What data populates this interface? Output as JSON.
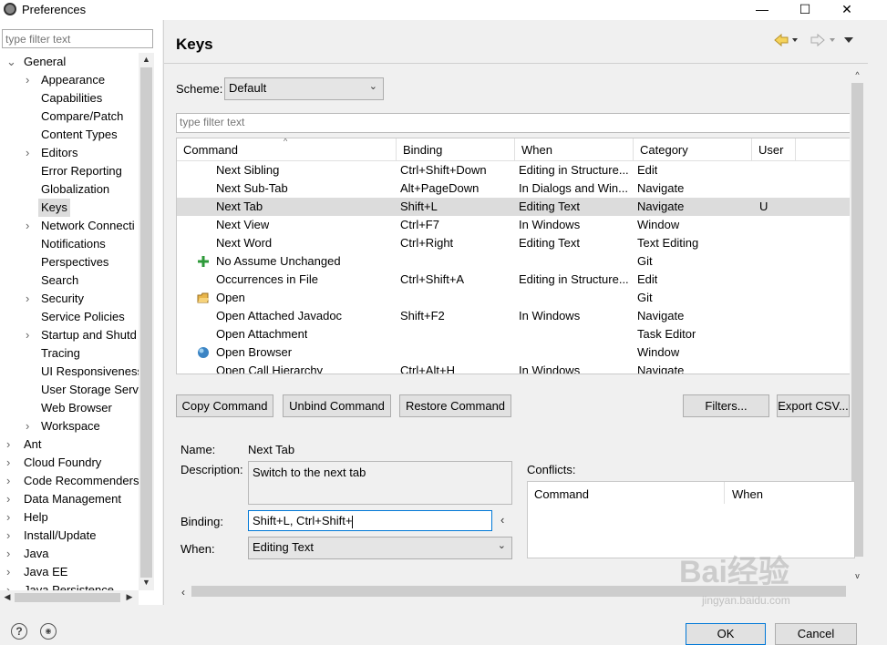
{
  "window": {
    "title": "Preferences",
    "minimize": "—",
    "maximize": "☐",
    "close": "✕"
  },
  "sidebar": {
    "filter_placeholder": "type filter text",
    "items": [
      {
        "label": "General",
        "level": 0,
        "expanded": true
      },
      {
        "label": "Appearance",
        "level": 1,
        "expandable": true
      },
      {
        "label": "Capabilities",
        "level": 1
      },
      {
        "label": "Compare/Patch",
        "level": 1
      },
      {
        "label": "Content Types",
        "level": 1
      },
      {
        "label": "Editors",
        "level": 1,
        "expandable": true
      },
      {
        "label": "Error Reporting",
        "level": 1
      },
      {
        "label": "Globalization",
        "level": 1
      },
      {
        "label": "Keys",
        "level": 1,
        "selected": true
      },
      {
        "label": "Network Connecti",
        "level": 1,
        "expandable": true
      },
      {
        "label": "Notifications",
        "level": 1
      },
      {
        "label": "Perspectives",
        "level": 1
      },
      {
        "label": "Search",
        "level": 1
      },
      {
        "label": "Security",
        "level": 1,
        "expandable": true
      },
      {
        "label": "Service Policies",
        "level": 1
      },
      {
        "label": "Startup and Shutd",
        "level": 1,
        "expandable": true
      },
      {
        "label": "Tracing",
        "level": 1
      },
      {
        "label": "UI Responsiveness",
        "level": 1
      },
      {
        "label": "User Storage Serv",
        "level": 1
      },
      {
        "label": "Web Browser",
        "level": 1
      },
      {
        "label": "Workspace",
        "level": 1,
        "expandable": true
      },
      {
        "label": "Ant",
        "level": 0,
        "expandable": true
      },
      {
        "label": "Cloud Foundry",
        "level": 0,
        "expandable": true
      },
      {
        "label": "Code Recommenders",
        "level": 0,
        "expandable": true
      },
      {
        "label": "Data Management",
        "level": 0,
        "expandable": true
      },
      {
        "label": "Help",
        "level": 0,
        "expandable": true
      },
      {
        "label": "Install/Update",
        "level": 0,
        "expandable": true
      },
      {
        "label": "Java",
        "level": 0,
        "expandable": true
      },
      {
        "label": "Java EE",
        "level": 0,
        "expandable": true
      },
      {
        "label": "Java Persistence",
        "level": 0,
        "expandable": true
      }
    ]
  },
  "main": {
    "title": "Keys",
    "scheme_label": "Scheme:",
    "scheme_value": "Default",
    "filter_placeholder": "type filter text",
    "columns": [
      "Command",
      "Binding",
      "When",
      "Category",
      "User"
    ],
    "rows": [
      {
        "command": "Next Sibling",
        "binding": "Ctrl+Shift+Down",
        "when": "Editing in Structure...",
        "category": "Edit",
        "user": "",
        "icon": ""
      },
      {
        "command": "Next Sub-Tab",
        "binding": "Alt+PageDown",
        "when": "In Dialogs and Win...",
        "category": "Navigate",
        "user": "",
        "icon": ""
      },
      {
        "command": "Next Tab",
        "binding": "Shift+L",
        "when": "Editing Text",
        "category": "Navigate",
        "user": "U",
        "icon": "",
        "selected": true
      },
      {
        "command": "Next View",
        "binding": "Ctrl+F7",
        "when": "In Windows",
        "category": "Window",
        "user": "",
        "icon": ""
      },
      {
        "command": "Next Word",
        "binding": "Ctrl+Right",
        "when": "Editing Text",
        "category": "Text Editing",
        "user": "",
        "icon": ""
      },
      {
        "command": "No Assume Unchanged",
        "binding": "",
        "when": "",
        "category": "Git",
        "user": "",
        "icon": "plus-arrows-icon"
      },
      {
        "command": "Occurrences in File",
        "binding": "Ctrl+Shift+A",
        "when": "Editing in Structure...",
        "category": "Edit",
        "user": "",
        "icon": ""
      },
      {
        "command": "Open",
        "binding": "",
        "when": "",
        "category": "Git",
        "user": "",
        "icon": "open-folder-icon"
      },
      {
        "command": "Open Attached Javadoc",
        "binding": "Shift+F2",
        "when": "In Windows",
        "category": "Navigate",
        "user": "",
        "icon": ""
      },
      {
        "command": "Open Attachment",
        "binding": "",
        "when": "",
        "category": "Task Editor",
        "user": "",
        "icon": ""
      },
      {
        "command": "Open Browser",
        "binding": "",
        "when": "",
        "category": "Window",
        "user": "",
        "icon": "globe-icon"
      },
      {
        "command": "Open Call Hierarchy",
        "binding": "Ctrl+Alt+H",
        "when": "In Windows",
        "category": "Navigate",
        "user": "",
        "icon": ""
      }
    ],
    "buttons": {
      "copy": "Copy Command",
      "unbind": "Unbind Command",
      "restore": "Restore Command",
      "filters": "Filters...",
      "export": "Export CSV..."
    },
    "details": {
      "name_label": "Name:",
      "name_value": "Next Tab",
      "description_label": "Description:",
      "description_value": "Switch to the next tab",
      "binding_label": "Binding:",
      "binding_value": "Shift+L, Ctrl+Shift+",
      "when_label": "When:",
      "when_value": "Editing Text",
      "conflicts_label": "Conflicts:",
      "conflicts_columns": [
        "Command",
        "When"
      ]
    }
  },
  "footer": {
    "ok": "OK",
    "cancel": "Cancel",
    "help": "?"
  },
  "watermark": {
    "text": "Bai经验",
    "sub": "jingyan.baidu.com"
  }
}
